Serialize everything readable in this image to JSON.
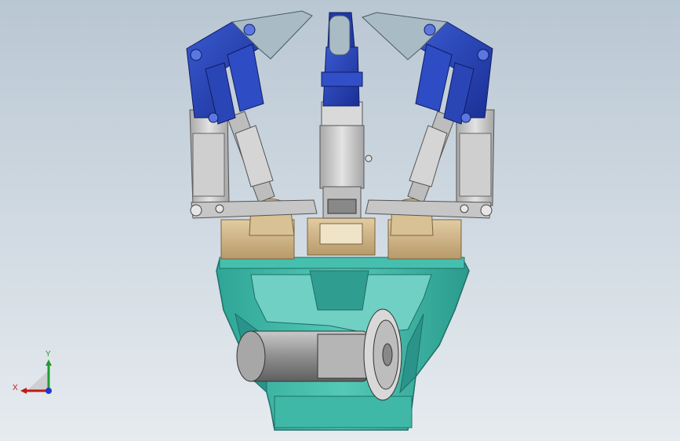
{
  "viewport": {
    "axes": {
      "x_label": "X",
      "y_label": "Y"
    },
    "colors": {
      "background_top": "#b9c7d3",
      "background_bottom": "#e6ebef",
      "finger_blue": "#2744b8",
      "finger_blue_dark": "#162a86",
      "steel_gray": "#c8c8c8",
      "steel_dark": "#7a7a7a",
      "bronze": "#cdb48a",
      "base_teal": "#3bb5a5",
      "base_teal_dark": "#1f7f73",
      "motor_gray": "#9a9a9a"
    }
  }
}
